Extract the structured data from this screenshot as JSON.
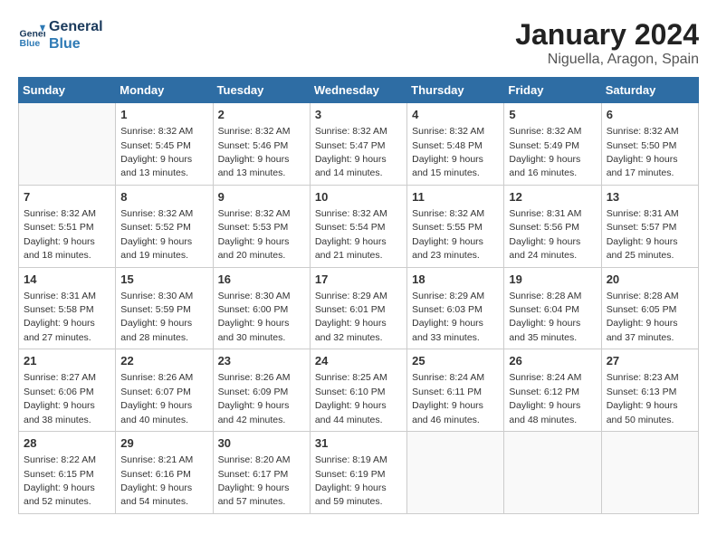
{
  "header": {
    "logo_line1": "General",
    "logo_line2": "Blue",
    "month": "January 2024",
    "location": "Niguella, Aragon, Spain"
  },
  "weekdays": [
    "Sunday",
    "Monday",
    "Tuesday",
    "Wednesday",
    "Thursday",
    "Friday",
    "Saturday"
  ],
  "weeks": [
    [
      {
        "day": "",
        "sunrise": "",
        "sunset": "",
        "daylight": ""
      },
      {
        "day": "1",
        "sunrise": "Sunrise: 8:32 AM",
        "sunset": "Sunset: 5:45 PM",
        "daylight": "Daylight: 9 hours and 13 minutes."
      },
      {
        "day": "2",
        "sunrise": "Sunrise: 8:32 AM",
        "sunset": "Sunset: 5:46 PM",
        "daylight": "Daylight: 9 hours and 13 minutes."
      },
      {
        "day": "3",
        "sunrise": "Sunrise: 8:32 AM",
        "sunset": "Sunset: 5:47 PM",
        "daylight": "Daylight: 9 hours and 14 minutes."
      },
      {
        "day": "4",
        "sunrise": "Sunrise: 8:32 AM",
        "sunset": "Sunset: 5:48 PM",
        "daylight": "Daylight: 9 hours and 15 minutes."
      },
      {
        "day": "5",
        "sunrise": "Sunrise: 8:32 AM",
        "sunset": "Sunset: 5:49 PM",
        "daylight": "Daylight: 9 hours and 16 minutes."
      },
      {
        "day": "6",
        "sunrise": "Sunrise: 8:32 AM",
        "sunset": "Sunset: 5:50 PM",
        "daylight": "Daylight: 9 hours and 17 minutes."
      }
    ],
    [
      {
        "day": "7",
        "sunrise": "Sunrise: 8:32 AM",
        "sunset": "Sunset: 5:51 PM",
        "daylight": "Daylight: 9 hours and 18 minutes."
      },
      {
        "day": "8",
        "sunrise": "Sunrise: 8:32 AM",
        "sunset": "Sunset: 5:52 PM",
        "daylight": "Daylight: 9 hours and 19 minutes."
      },
      {
        "day": "9",
        "sunrise": "Sunrise: 8:32 AM",
        "sunset": "Sunset: 5:53 PM",
        "daylight": "Daylight: 9 hours and 20 minutes."
      },
      {
        "day": "10",
        "sunrise": "Sunrise: 8:32 AM",
        "sunset": "Sunset: 5:54 PM",
        "daylight": "Daylight: 9 hours and 21 minutes."
      },
      {
        "day": "11",
        "sunrise": "Sunrise: 8:32 AM",
        "sunset": "Sunset: 5:55 PM",
        "daylight": "Daylight: 9 hours and 23 minutes."
      },
      {
        "day": "12",
        "sunrise": "Sunrise: 8:31 AM",
        "sunset": "Sunset: 5:56 PM",
        "daylight": "Daylight: 9 hours and 24 minutes."
      },
      {
        "day": "13",
        "sunrise": "Sunrise: 8:31 AM",
        "sunset": "Sunset: 5:57 PM",
        "daylight": "Daylight: 9 hours and 25 minutes."
      }
    ],
    [
      {
        "day": "14",
        "sunrise": "Sunrise: 8:31 AM",
        "sunset": "Sunset: 5:58 PM",
        "daylight": "Daylight: 9 hours and 27 minutes."
      },
      {
        "day": "15",
        "sunrise": "Sunrise: 8:30 AM",
        "sunset": "Sunset: 5:59 PM",
        "daylight": "Daylight: 9 hours and 28 minutes."
      },
      {
        "day": "16",
        "sunrise": "Sunrise: 8:30 AM",
        "sunset": "Sunset: 6:00 PM",
        "daylight": "Daylight: 9 hours and 30 minutes."
      },
      {
        "day": "17",
        "sunrise": "Sunrise: 8:29 AM",
        "sunset": "Sunset: 6:01 PM",
        "daylight": "Daylight: 9 hours and 32 minutes."
      },
      {
        "day": "18",
        "sunrise": "Sunrise: 8:29 AM",
        "sunset": "Sunset: 6:03 PM",
        "daylight": "Daylight: 9 hours and 33 minutes."
      },
      {
        "day": "19",
        "sunrise": "Sunrise: 8:28 AM",
        "sunset": "Sunset: 6:04 PM",
        "daylight": "Daylight: 9 hours and 35 minutes."
      },
      {
        "day": "20",
        "sunrise": "Sunrise: 8:28 AM",
        "sunset": "Sunset: 6:05 PM",
        "daylight": "Daylight: 9 hours and 37 minutes."
      }
    ],
    [
      {
        "day": "21",
        "sunrise": "Sunrise: 8:27 AM",
        "sunset": "Sunset: 6:06 PM",
        "daylight": "Daylight: 9 hours and 38 minutes."
      },
      {
        "day": "22",
        "sunrise": "Sunrise: 8:26 AM",
        "sunset": "Sunset: 6:07 PM",
        "daylight": "Daylight: 9 hours and 40 minutes."
      },
      {
        "day": "23",
        "sunrise": "Sunrise: 8:26 AM",
        "sunset": "Sunset: 6:09 PM",
        "daylight": "Daylight: 9 hours and 42 minutes."
      },
      {
        "day": "24",
        "sunrise": "Sunrise: 8:25 AM",
        "sunset": "Sunset: 6:10 PM",
        "daylight": "Daylight: 9 hours and 44 minutes."
      },
      {
        "day": "25",
        "sunrise": "Sunrise: 8:24 AM",
        "sunset": "Sunset: 6:11 PM",
        "daylight": "Daylight: 9 hours and 46 minutes."
      },
      {
        "day": "26",
        "sunrise": "Sunrise: 8:24 AM",
        "sunset": "Sunset: 6:12 PM",
        "daylight": "Daylight: 9 hours and 48 minutes."
      },
      {
        "day": "27",
        "sunrise": "Sunrise: 8:23 AM",
        "sunset": "Sunset: 6:13 PM",
        "daylight": "Daylight: 9 hours and 50 minutes."
      }
    ],
    [
      {
        "day": "28",
        "sunrise": "Sunrise: 8:22 AM",
        "sunset": "Sunset: 6:15 PM",
        "daylight": "Daylight: 9 hours and 52 minutes."
      },
      {
        "day": "29",
        "sunrise": "Sunrise: 8:21 AM",
        "sunset": "Sunset: 6:16 PM",
        "daylight": "Daylight: 9 hours and 54 minutes."
      },
      {
        "day": "30",
        "sunrise": "Sunrise: 8:20 AM",
        "sunset": "Sunset: 6:17 PM",
        "daylight": "Daylight: 9 hours and 57 minutes."
      },
      {
        "day": "31",
        "sunrise": "Sunrise: 8:19 AM",
        "sunset": "Sunset: 6:19 PM",
        "daylight": "Daylight: 9 hours and 59 minutes."
      },
      {
        "day": "",
        "sunrise": "",
        "sunset": "",
        "daylight": ""
      },
      {
        "day": "",
        "sunrise": "",
        "sunset": "",
        "daylight": ""
      },
      {
        "day": "",
        "sunrise": "",
        "sunset": "",
        "daylight": ""
      }
    ]
  ]
}
